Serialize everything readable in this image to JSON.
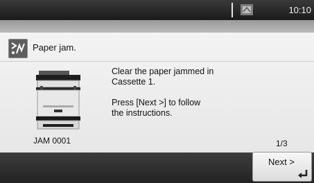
{
  "status_bar": {
    "time": "10:10",
    "icon": "paper-tray-icon"
  },
  "alert": {
    "icon": "paper-jam-icon",
    "title": "Paper jam."
  },
  "device": {
    "image": "printer-icon",
    "jam_code": "JAM 0001"
  },
  "message": {
    "line1": "Clear the paper jammed in",
    "line2": "Cassette 1.",
    "line3": "Press [Next >] to follow",
    "line4": "the instructions."
  },
  "pagination": {
    "label": "1/3"
  },
  "actions": {
    "next_label": "Next >",
    "next_icon": "enter-icon"
  }
}
